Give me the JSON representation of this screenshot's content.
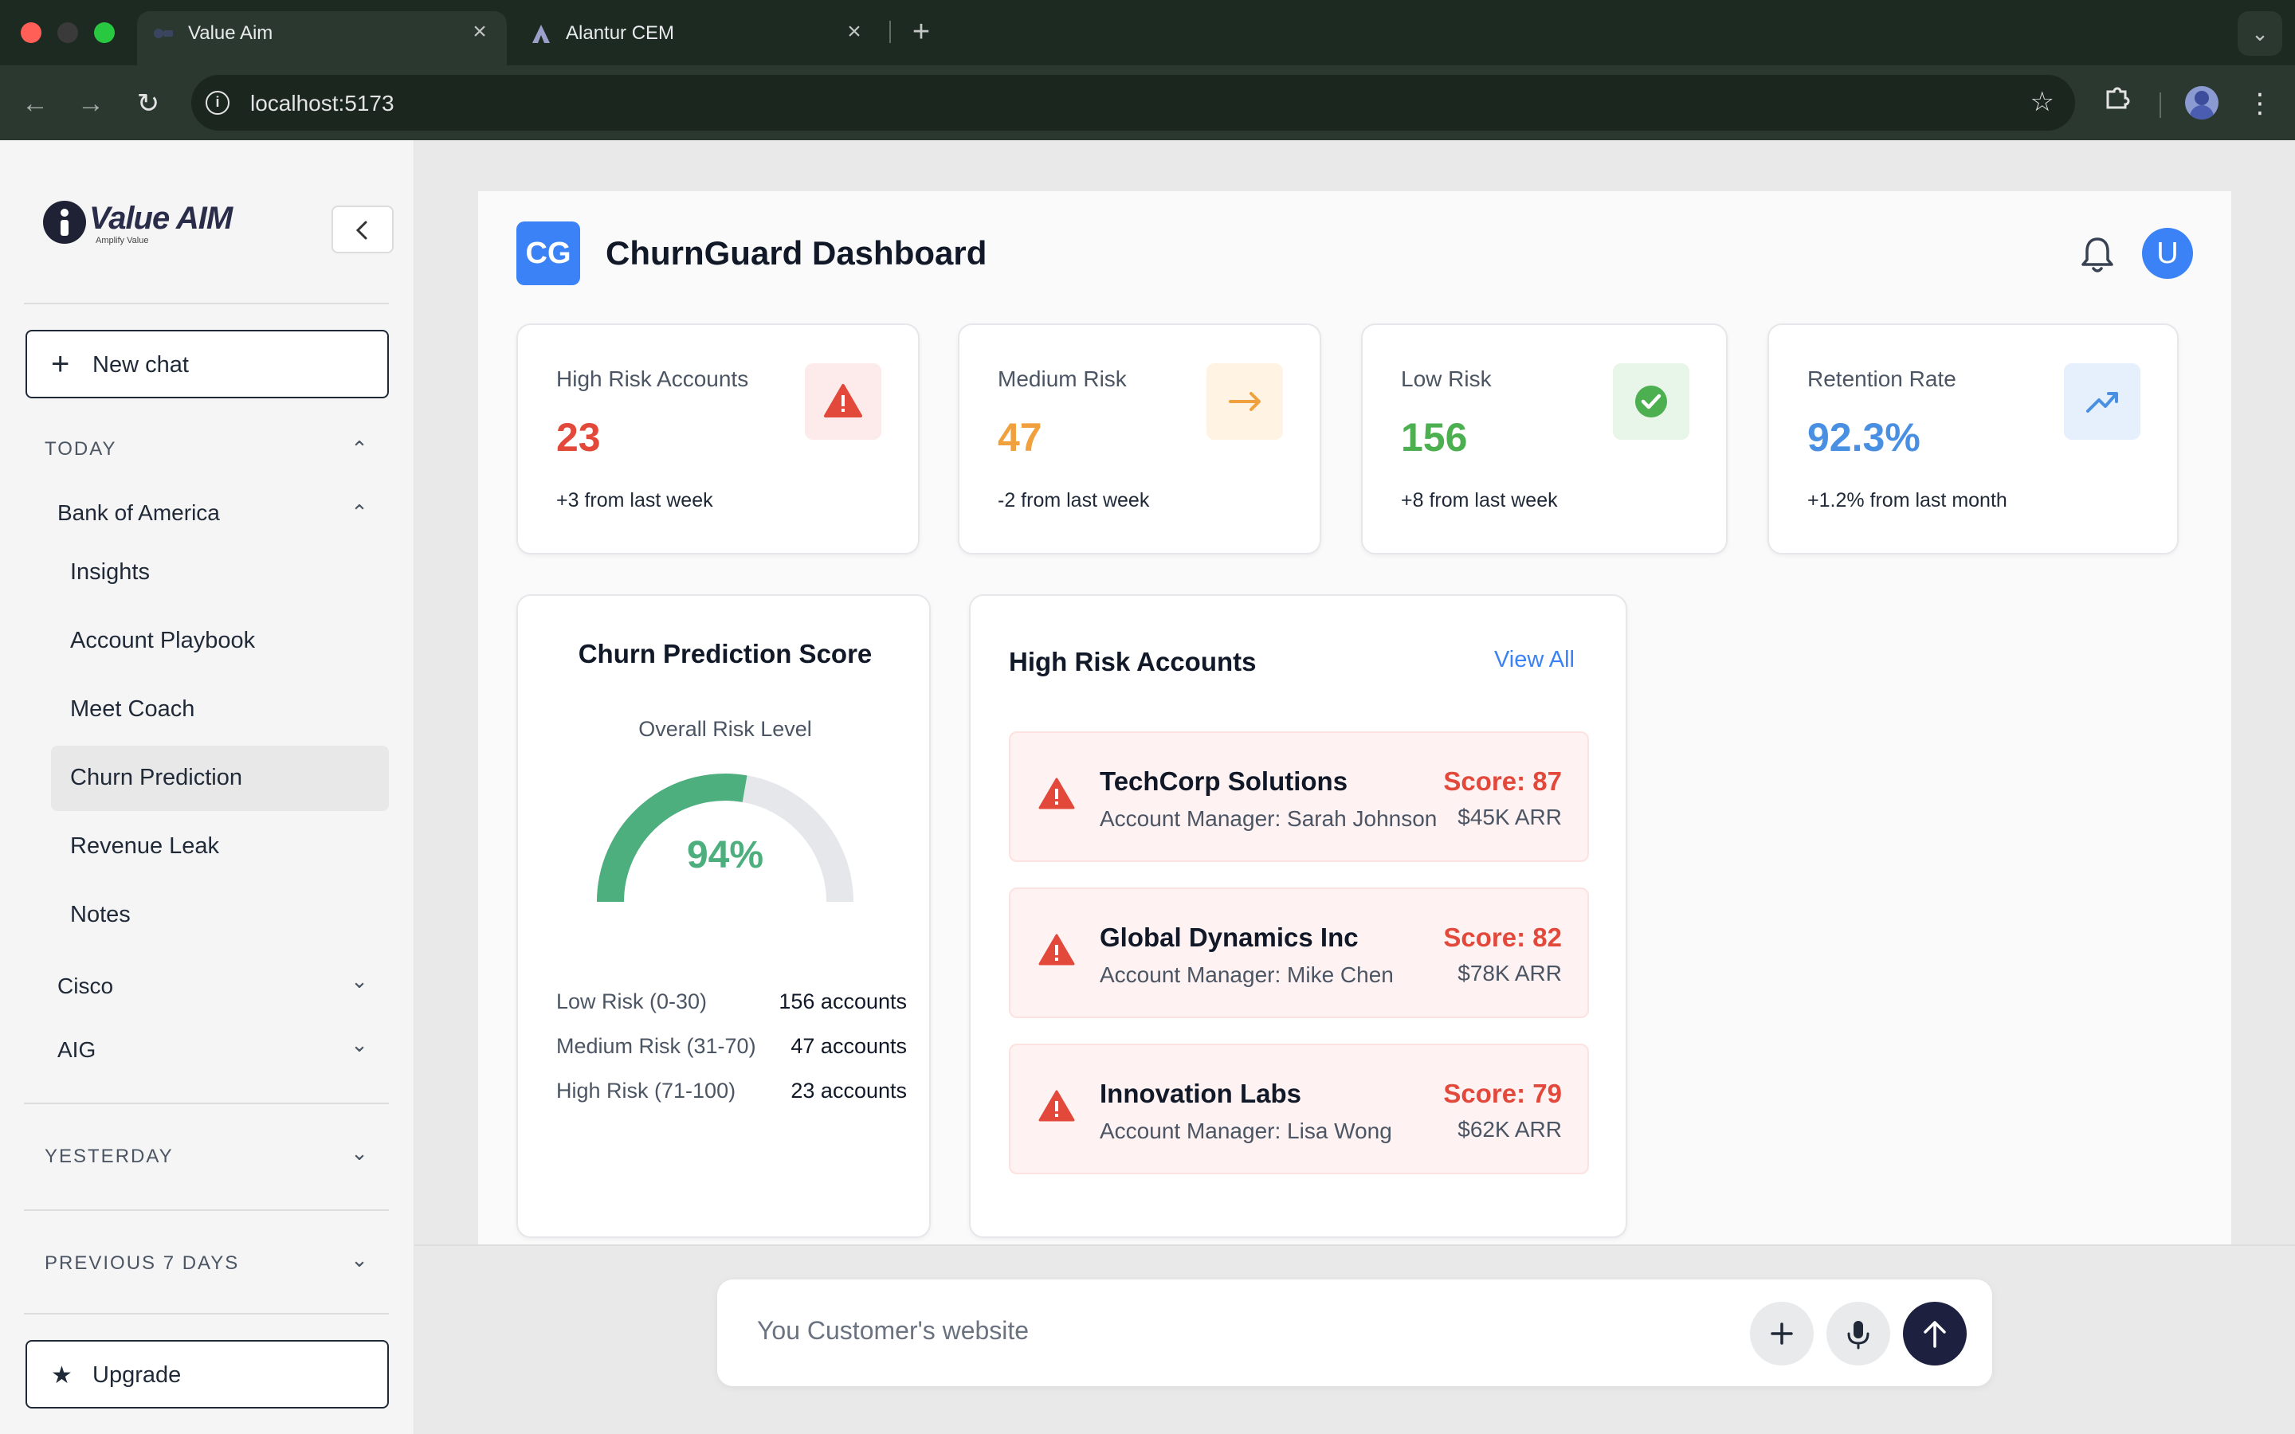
{
  "browser": {
    "tabs": [
      {
        "title": "Value Aim",
        "active": true
      },
      {
        "title": "Alantur CEM",
        "active": false
      }
    ],
    "url": "localhost:5173"
  },
  "sidebar": {
    "logo_text": "Value AIM",
    "logo_sub": "Amplify Value",
    "new_chat": "New chat",
    "sections": {
      "today": "TODAY",
      "yesterday": "YESTERDAY",
      "previous": "PREVIOUS 7 DAYS"
    },
    "groups": {
      "bank": "Bank of America",
      "cisco": "Cisco",
      "aig": "AIG"
    },
    "items": [
      {
        "label": "Insights",
        "active": false
      },
      {
        "label": "Account Playbook",
        "active": false
      },
      {
        "label": "Meet Coach",
        "active": false
      },
      {
        "label": "Churn Prediction",
        "active": true
      },
      {
        "label": "Revenue Leak",
        "active": false
      },
      {
        "label": "Notes",
        "active": false
      }
    ],
    "upgrade": "Upgrade"
  },
  "dashboard": {
    "badge": "CG",
    "title": "ChurnGuard Dashboard",
    "avatar": "U",
    "stats": [
      {
        "label": "High Risk Accounts",
        "value": "23",
        "change": "+3 from last week",
        "color": "#e2493b",
        "icon": "warning-icon",
        "icon_bg": "#fdeaea"
      },
      {
        "label": "Medium Risk",
        "value": "47",
        "change": "-2 from last week",
        "color": "#f0a03c",
        "icon": "arrow-right-icon",
        "icon_bg": "#fff4e4"
      },
      {
        "label": "Low Risk",
        "value": "156",
        "change": "+8 from last week",
        "color": "#4caf50",
        "icon": "check-circle-icon",
        "icon_bg": "#e8f5e9"
      },
      {
        "label": "Retention Rate",
        "value": "92.3%",
        "change": "+1.2% from last month",
        "color": "#4a90e2",
        "icon": "trending-up-icon",
        "icon_bg": "#e6f0fd"
      }
    ],
    "gauge": {
      "title": "Churn Prediction Score",
      "subtitle": "Overall Risk Level",
      "percent": 94,
      "percent_label": "94%",
      "fill_color": "#4caf7d",
      "track_color": "#e5e7eb",
      "legend": [
        {
          "label": "Low Risk (0-30)",
          "value": "156 accounts"
        },
        {
          "label": "Medium Risk (31-70)",
          "value": "47 accounts"
        },
        {
          "label": "High Risk (71-100)",
          "value": "23 accounts"
        }
      ]
    },
    "high_risk": {
      "title": "High Risk Accounts",
      "view_all": "View All",
      "accounts": [
        {
          "name": "TechCorp Solutions",
          "manager": "Account Manager: Sarah Johnson",
          "score": "Score: 87",
          "arr": "$45K ARR"
        },
        {
          "name": "Global Dynamics Inc",
          "manager": "Account Manager: Mike Chen",
          "score": "Score: 82",
          "arr": "$78K ARR"
        },
        {
          "name": "Innovation Labs",
          "manager": "Account Manager: Lisa Wong",
          "score": "Score: 79",
          "arr": "$62K ARR"
        }
      ]
    }
  },
  "chat": {
    "placeholder": "You Customer's website"
  }
}
